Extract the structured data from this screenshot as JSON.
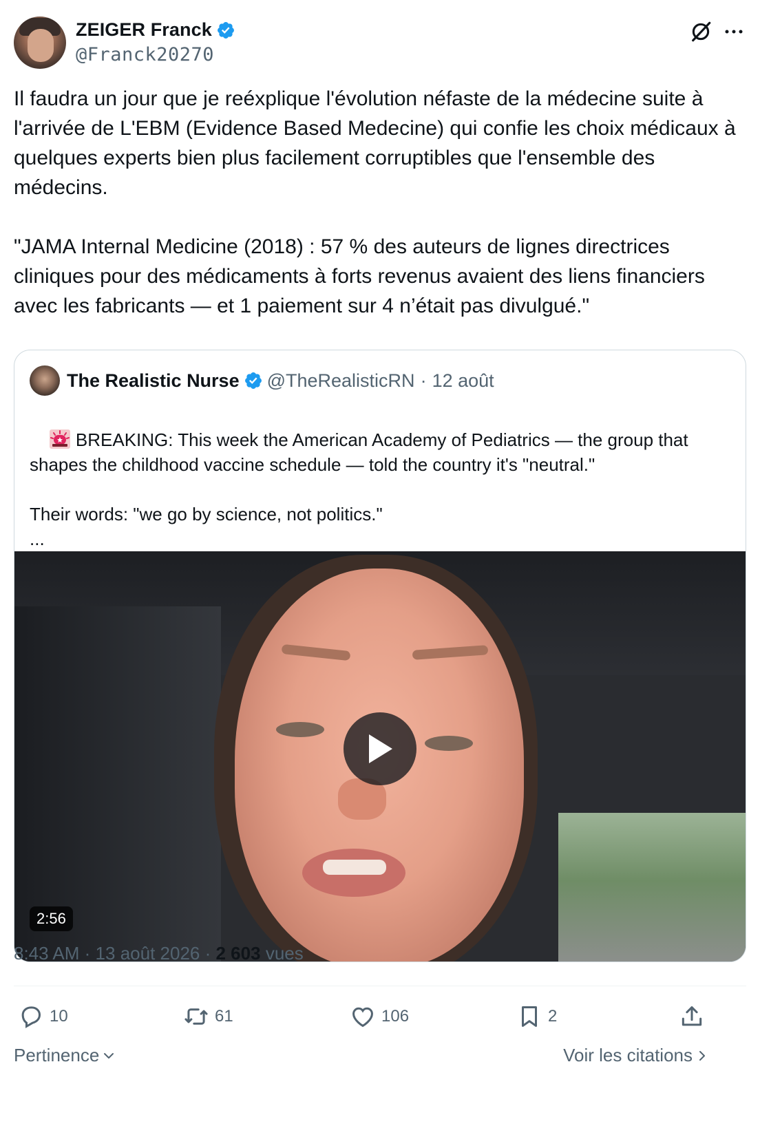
{
  "author": {
    "name": "ZEIGER Franck",
    "handle": "@Franck20270"
  },
  "tweet": {
    "text": "Il faudra un jour que je reéxplique l'évolution néfaste de la médecine suite à l'arrivée de L'EBM (Evidence Based Medecine) qui confie les choix médicaux à quelques experts bien plus facilement corruptibles que l'ensemble des médecins.\n\n\"JAMA Internal Medicine (2018) : 57 % des auteurs de lignes directrices cliniques pour des médicaments à forts revenus avaient des liens financiers avec les fabricants — et 1 paiement sur 4 n’était pas divulgué.\""
  },
  "quoted": {
    "name": "The Realistic Nurse",
    "handle": "@TheRealisticRN",
    "date": "12 août",
    "separator": "·",
    "icon": "rotating-light-emoji",
    "text": "BREAKING: This week the American Academy of Pediatrics — the group that shapes the childhood vaccine schedule — told the country it's \"neutral.\"\n\nTheir words: \"we go by science, not politics.\"\n...",
    "video_duration": "2:56"
  },
  "meta": {
    "time": "8:43 AM",
    "date": "13 août 2026",
    "views_count": "2 603",
    "views_label": "vues",
    "separator": "·"
  },
  "actions": {
    "replies": "10",
    "reposts": "61",
    "likes": "106",
    "bookmarks": "2"
  },
  "footer": {
    "sort_label": "Pertinence",
    "quotes_label": "Voir les citations"
  },
  "colors": {
    "verified": "#1d9bf0",
    "text": "#0f1419",
    "secondary": "#536471",
    "border": "#cfd9de"
  }
}
